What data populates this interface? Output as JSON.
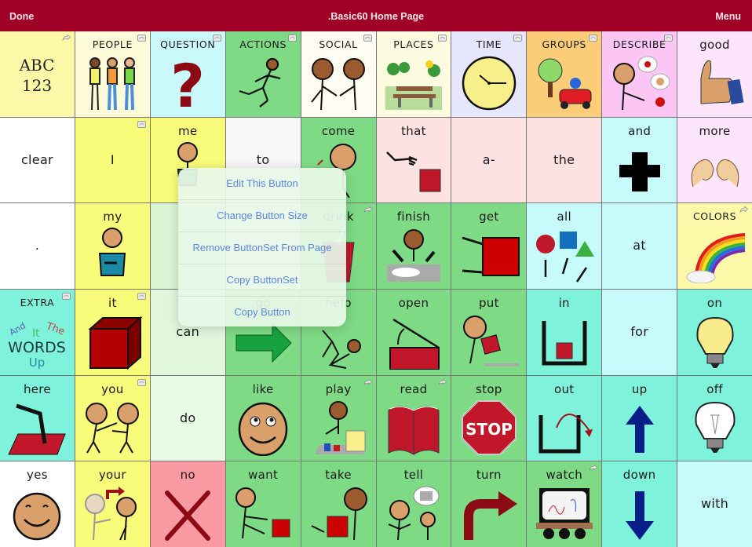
{
  "topbar": {
    "done_label": "Done",
    "title": ".Basic60 Home Page",
    "menu_label": "Menu",
    "background": "#a00026"
  },
  "popup_menu": {
    "items": [
      "Edit This Button",
      "Change Button Size",
      "Remove ButtonSet From Page",
      "Copy ButtonSet",
      "Copy Button"
    ],
    "text_color": "#5b86e0"
  },
  "grid": {
    "columns": 10,
    "rows": 6,
    "cells": [
      {
        "label": "ABC 123",
        "bg": "#fdf9a8",
        "icon": "abc-123-text",
        "corner": "link-icon",
        "style": "text"
      },
      {
        "label": "PEOPLE",
        "bg": "#fefbd9",
        "icon": "people-icon",
        "corner": "folder-icon",
        "style": "caps"
      },
      {
        "label": "QUESTION",
        "bg": "#c9f9fb",
        "icon": "question-mark-icon",
        "corner": "folder-icon",
        "style": "caps"
      },
      {
        "label": "ACTIONS",
        "bg": "#7fda85",
        "icon": "running-person-icon",
        "corner": "folder-icon",
        "style": "caps"
      },
      {
        "label": "SOCIAL",
        "bg": "#fffdf2",
        "icon": "handshake-icon",
        "corner": "folder-icon",
        "style": "caps"
      },
      {
        "label": "PLACES",
        "bg": "#fdfce0",
        "icon": "park-bench-icon",
        "corner": "folder-icon",
        "style": "caps"
      },
      {
        "label": "TIME",
        "bg": "#e6e6fc",
        "icon": "clock-icon",
        "corner": "folder-icon",
        "style": "caps"
      },
      {
        "label": "GROUPS",
        "bg": "#fbcd78",
        "icon": "tree-car-icon",
        "corner": "folder-icon",
        "style": "caps"
      },
      {
        "label": "DESCRIBE",
        "bg": "#fbc6f4",
        "icon": "describe-person-icon",
        "corner": "folder-icon",
        "style": "caps"
      },
      {
        "label": "good",
        "bg": "#fde6fb",
        "icon": "thumbs-up-icon",
        "corner": "",
        "style": "word"
      },
      {
        "label": "clear",
        "bg": "#ffffff",
        "icon": "",
        "corner": "",
        "style": "center"
      },
      {
        "label": "I",
        "bg": "#f9fb7a",
        "icon": "",
        "corner": "folder-icon",
        "style": "center"
      },
      {
        "label": "me",
        "bg": "#f9fb7a",
        "icon": "person-me-icon",
        "corner": "",
        "style": "word"
      },
      {
        "label": "to",
        "bg": "#f7f7f7",
        "icon": "",
        "corner": "",
        "style": "center"
      },
      {
        "label": "come",
        "bg": "#7fda85",
        "icon": "person-come-icon",
        "corner": "",
        "style": "word"
      },
      {
        "label": "that",
        "bg": "#fde2e2",
        "icon": "point-that-icon",
        "corner": "",
        "style": "word"
      },
      {
        "label": "a-",
        "bg": "#fde2e2",
        "icon": "",
        "corner": "",
        "style": "center"
      },
      {
        "label": "the",
        "bg": "#fde2e2",
        "icon": "",
        "corner": "",
        "style": "center"
      },
      {
        "label": "and",
        "bg": "#c7fbfb",
        "icon": "plus-icon",
        "corner": "",
        "style": "word"
      },
      {
        "label": "more",
        "bg": "#fde6fb",
        "icon": "more-hands-icon",
        "corner": "",
        "style": "word"
      },
      {
        "label": ".",
        "bg": "#ffffff",
        "icon": "",
        "corner": "",
        "style": "center"
      },
      {
        "label": "my",
        "bg": "#f9fb7a",
        "icon": "person-my-icon",
        "corner": "",
        "style": "word"
      },
      {
        "label": "",
        "bg": "#d8f5d4",
        "icon": "",
        "corner": "",
        "style": "word"
      },
      {
        "label": "",
        "bg": "#ffffff",
        "icon": "",
        "corner": "",
        "style": "word"
      },
      {
        "label": "drink",
        "bg": "#7fda85",
        "icon": "cup-icon",
        "corner": "link-icon",
        "style": "word"
      },
      {
        "label": "finish",
        "bg": "#7fda85",
        "icon": "finish-plate-icon",
        "corner": "",
        "style": "word"
      },
      {
        "label": "get",
        "bg": "#7fda85",
        "icon": "get-box-icon",
        "corner": "",
        "style": "word"
      },
      {
        "label": "all",
        "bg": "#c7fbfb",
        "icon": "shapes-icon",
        "corner": "",
        "style": "word"
      },
      {
        "label": "at",
        "bg": "#c7fbfb",
        "icon": "",
        "corner": "",
        "style": "center"
      },
      {
        "label": "COLORS",
        "bg": "#fdf9a8",
        "icon": "rainbow-icon",
        "corner": "link-icon",
        "style": "caps"
      },
      {
        "label": "EXTRA",
        "bg": "#7ff2dc",
        "icon": "extra-words-icon",
        "corner": "folder-icon",
        "style": "caps"
      },
      {
        "label": "it",
        "bg": "#f9fb7a",
        "icon": "red-cube-icon",
        "corner": "folder-icon",
        "style": "word"
      },
      {
        "label": "can",
        "bg": "#e0f7dc",
        "icon": "",
        "corner": "",
        "style": "center"
      },
      {
        "label": "go",
        "bg": "#7fda85",
        "icon": "green-arrow-icon",
        "corner": "",
        "style": "word"
      },
      {
        "label": "help",
        "bg": "#7fda85",
        "icon": "help-person-icon",
        "corner": "",
        "style": "word"
      },
      {
        "label": "open",
        "bg": "#7fda85",
        "icon": "open-box-icon",
        "corner": "",
        "style": "word"
      },
      {
        "label": "put",
        "bg": "#7fda85",
        "icon": "put-box-icon",
        "corner": "",
        "style": "word"
      },
      {
        "label": "in",
        "bg": "#7ff2dc",
        "icon": "box-in-icon",
        "corner": "",
        "style": "word"
      },
      {
        "label": "for",
        "bg": "#c7fbfb",
        "icon": "",
        "corner": "",
        "style": "center"
      },
      {
        "label": "on",
        "bg": "#7ff2dc",
        "icon": "light-on-icon",
        "corner": "",
        "style": "word"
      },
      {
        "label": "here",
        "bg": "#7ff2dc",
        "icon": "point-here-icon",
        "corner": "",
        "style": "word"
      },
      {
        "label": "you",
        "bg": "#f9fb7a",
        "icon": "people-you-icon",
        "corner": "folder-icon",
        "style": "word"
      },
      {
        "label": "do",
        "bg": "#e8fbe4",
        "icon": "",
        "corner": "",
        "style": "center"
      },
      {
        "label": "like",
        "bg": "#7fda85",
        "icon": "like-face-icon",
        "corner": "",
        "style": "word"
      },
      {
        "label": "play",
        "bg": "#7fda85",
        "icon": "play-toys-icon",
        "corner": "link-icon",
        "style": "word"
      },
      {
        "label": "read",
        "bg": "#7fda85",
        "icon": "book-icon",
        "corner": "link-icon",
        "style": "word"
      },
      {
        "label": "stop",
        "bg": "#7fda85",
        "icon": "stop-sign-icon",
        "corner": "",
        "style": "word"
      },
      {
        "label": "out",
        "bg": "#7ff2dc",
        "icon": "out-arrow-icon",
        "corner": "",
        "style": "word"
      },
      {
        "label": "up",
        "bg": "#7ff2dc",
        "icon": "up-arrow-icon",
        "corner": "",
        "style": "word"
      },
      {
        "label": "off",
        "bg": "#7ff2dc",
        "icon": "light-off-icon",
        "corner": "",
        "style": "word"
      },
      {
        "label": "yes",
        "bg": "#ffffff",
        "icon": "smile-face-icon",
        "corner": "",
        "style": "word"
      },
      {
        "label": "your",
        "bg": "#f9fb7a",
        "icon": "people-your-icon",
        "corner": "",
        "style": "word"
      },
      {
        "label": "no",
        "bg": "#f99aa3",
        "icon": "red-x-icon",
        "corner": "",
        "style": "word"
      },
      {
        "label": "want",
        "bg": "#7fda85",
        "icon": "want-box-icon",
        "corner": "",
        "style": "word"
      },
      {
        "label": "take",
        "bg": "#7fda85",
        "icon": "take-box-icon",
        "corner": "",
        "style": "word"
      },
      {
        "label": "tell",
        "bg": "#7fda85",
        "icon": "tell-story-icon",
        "corner": "",
        "style": "word"
      },
      {
        "label": "turn",
        "bg": "#7fda85",
        "icon": "turn-arrow-icon",
        "corner": "",
        "style": "word"
      },
      {
        "label": "watch",
        "bg": "#7fda85",
        "icon": "tv-watch-icon",
        "corner": "link-icon",
        "style": "word"
      },
      {
        "label": "down",
        "bg": "#7ff2dc",
        "icon": "down-arrow-icon",
        "corner": "",
        "style": "word"
      },
      {
        "label": "with",
        "bg": "#c7fbfb",
        "icon": "",
        "corner": "",
        "style": "center"
      }
    ]
  }
}
